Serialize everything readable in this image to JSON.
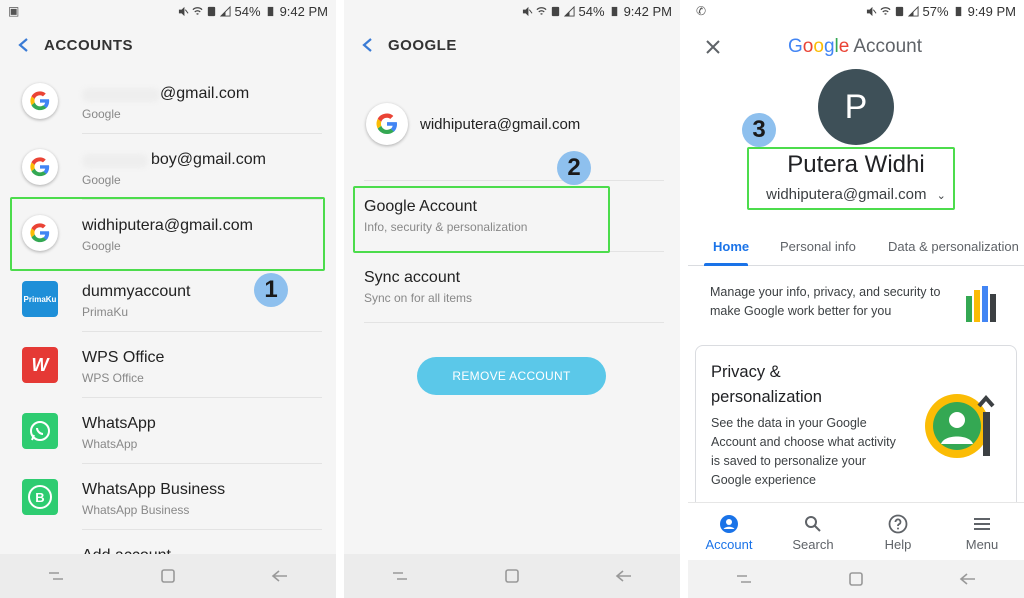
{
  "panel1": {
    "status": {
      "time": "9:42 PM",
      "battery": "54%"
    },
    "title": "ACCOUNTS",
    "accounts": [
      {
        "title": "@gmail.com",
        "sub": "Google",
        "icon": "google-icon"
      },
      {
        "title": "boy@gmail.com",
        "sub": "Google",
        "icon": "google-icon"
      },
      {
        "title": "widhiputera@gmail.com",
        "sub": "Google",
        "icon": "google-icon"
      },
      {
        "title": "dummyaccount",
        "sub": "PrimaKu",
        "icon": "primaku-icon",
        "icon_text": "PrimaKu"
      },
      {
        "title": "WPS Office",
        "sub": "WPS Office",
        "icon": "wps-office-icon",
        "icon_text": "W"
      },
      {
        "title": "WhatsApp",
        "sub": "WhatsApp",
        "icon": "whatsapp-icon"
      },
      {
        "title": "WhatsApp Business",
        "sub": "WhatsApp Business",
        "icon": "whatsapp-business-icon",
        "icon_text": "B"
      },
      {
        "title": "Add account",
        "sub": "",
        "icon": "plus-icon"
      }
    ],
    "step": "1"
  },
  "panel2": {
    "status": {
      "time": "9:42 PM",
      "battery": "54%"
    },
    "title": "GOOGLE",
    "account_email": "widhiputera@gmail.com",
    "google_account": {
      "title": "Google Account",
      "sub": "Info, security & personalization"
    },
    "sync": {
      "title": "Sync account",
      "sub": "Sync on for all items"
    },
    "remove_label": "REMOVE ACCOUNT",
    "step": "2"
  },
  "panel3": {
    "status": {
      "time": "9:49 PM",
      "battery": "57%"
    },
    "brand": {
      "g1": "G",
      "o1": "o",
      "o2": "o",
      "g2": "g",
      "l": "l",
      "e": "e",
      "account": "Account"
    },
    "avatar_letter": "P",
    "name": "Putera Widhi",
    "email": "widhiputera@gmail.com",
    "tabs": [
      "Home",
      "Personal info",
      "Data & personalization"
    ],
    "intro": "Manage your info, privacy, and security to make Google work better for you",
    "card": {
      "title": "Privacy & personalization",
      "body": "See the data in your Google Account and choose what activity is saved to personalize your Google experience"
    },
    "bottom_nav": [
      "Account",
      "Search",
      "Help",
      "Menu"
    ],
    "step": "3"
  },
  "colors": {
    "highlight": "#4cdc4c",
    "step_badge": "#8ec0ee",
    "accent": "#1a73e8",
    "remove_button": "#5bc8e9"
  }
}
